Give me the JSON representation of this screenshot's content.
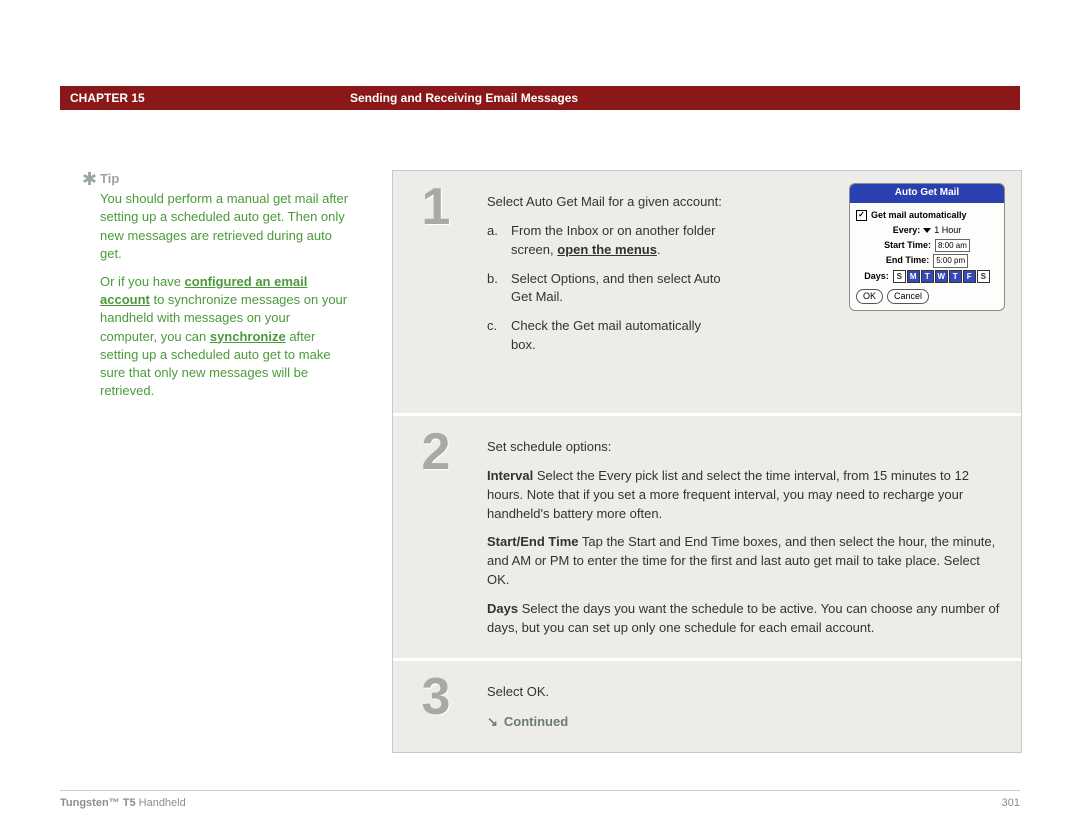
{
  "header": {
    "chapter": "CHAPTER 15",
    "title": "Sending and Receiving Email Messages"
  },
  "sidebar": {
    "tip_label": "Tip",
    "p1": "You should perform a manual get mail after setting up a scheduled auto get. Then only new messages are retrieved during auto get.",
    "p2a": "Or if you have ",
    "p2link1": "configured an email account",
    "p2b": " to synchronize messages on your handheld with messages on your computer, you can ",
    "p2link2": "synchronize",
    "p2c": " after setting up a scheduled auto get to make sure that only new messages will be retrieved."
  },
  "steps": {
    "s1": {
      "num": "1",
      "lead": "Select Auto Get Mail for a given account:",
      "a_lbl": "a.",
      "a_pre": "From the Inbox or on another folder screen, ",
      "a_link": "open the menus",
      "a_post": ".",
      "b_lbl": "b.",
      "b": "Select Options, and then select Auto Get Mail.",
      "c_lbl": "c.",
      "c": "Check the Get mail automatically box."
    },
    "s2": {
      "num": "2",
      "lead": "Set schedule options:",
      "interval_h": "Interval",
      "interval": "   Select the Every pick list and select the time interval, from 15 minutes to 12 hours. Note that if you set a more frequent interval, you may need to recharge your handheld's battery more often.",
      "startend_h": "Start/End Time",
      "startend": "   Tap the Start and End Time boxes, and then select the hour, the minute, and AM or PM to enter the time for the first and last auto get mail to take place. Select OK.",
      "days_h": "Days",
      "days": "   Select the days you want the schedule to be active. You can choose any number of days, but you can set up only one schedule for each email account."
    },
    "s3": {
      "num": "3",
      "lead": "Select OK.",
      "cont": "Continued"
    }
  },
  "device": {
    "title": "Auto Get Mail",
    "automatically": "Get mail automatically",
    "every_lbl": "Every:",
    "every_val": "1 Hour",
    "start_lbl": "Start Time:",
    "start_val": "8:00 am",
    "end_lbl": "End Time:",
    "end_val": "5:00 pm",
    "days_lbl": "Days:",
    "days": [
      "S",
      "M",
      "T",
      "W",
      "T",
      "F",
      "S"
    ],
    "ok": "OK",
    "cancel": "Cancel"
  },
  "footer": {
    "left_b": "Tungsten™ T5",
    "left": " Handheld",
    "page": "301"
  }
}
